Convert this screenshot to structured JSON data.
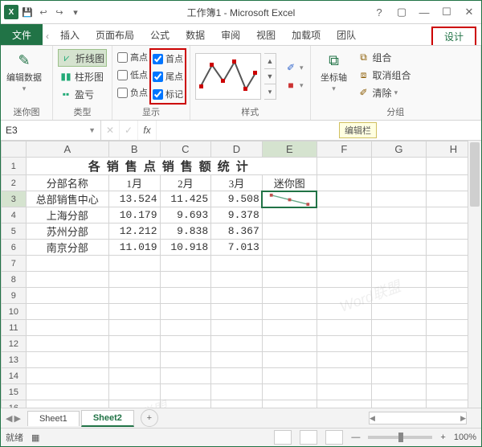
{
  "window": {
    "title": "工作簿1 - Microsoft Excel"
  },
  "qat": {
    "save": "💾",
    "undo": "↩",
    "redo": "↪",
    "dd": "▾"
  },
  "tabs": {
    "file": "文件",
    "items": [
      "插入",
      "页面布局",
      "公式",
      "数据",
      "审阅",
      "视图",
      "加载项",
      "团队"
    ],
    "design": "设计"
  },
  "ribbon": {
    "groups": {
      "mini": "迷你图",
      "type": "类型",
      "show": "显示",
      "style": "样式",
      "group": "分组"
    },
    "edit_data": "编辑数据",
    "types": {
      "line": "折线图",
      "column": "柱形图",
      "winloss": "盈亏"
    },
    "show": {
      "high": "高点",
      "low": "低点",
      "neg": "负点",
      "first": "首点",
      "last": "尾点",
      "markers": "标记"
    },
    "axis": "坐标轴",
    "grp": {
      "combine": "组合",
      "ungroup": "取消组合",
      "clear": "清除"
    }
  },
  "formula_bar": {
    "namebox": "E3",
    "fx": "fx",
    "tip": "编辑栏"
  },
  "sheet": {
    "columns": [
      "A",
      "B",
      "C",
      "D",
      "E",
      "F",
      "G",
      "H"
    ],
    "title": "各销售点销售额统计",
    "headers": {
      "name": "分部名称",
      "m1": "1月",
      "m2": "2月",
      "m3": "3月",
      "spark": "迷你图"
    },
    "rows": [
      {
        "name": "总部销售中心",
        "m1": "13.524",
        "m2": "11.425",
        "m3": "9.508"
      },
      {
        "name": "上海分部",
        "m1": "10.179",
        "m2": "9.693",
        "m3": "9.378"
      },
      {
        "name": "苏州分部",
        "m1": "12.212",
        "m2": "9.838",
        "m3": "8.367"
      },
      {
        "name": "南京分部",
        "m1": "11.019",
        "m2": "10.918",
        "m3": "7.013"
      }
    ],
    "row_count": 16
  },
  "sheet_tabs": {
    "tabs": [
      "Sheet1",
      "Sheet2"
    ],
    "active": 1
  },
  "status": {
    "ready": "就绪",
    "zoom": "100%"
  },
  "chart_data": {
    "type": "line",
    "note": "迷你图 sparkline in E3 plus ribbon style preview",
    "categories": [
      "1月",
      "2月",
      "3月"
    ],
    "series": [
      {
        "name": "总部销售中心",
        "values": [
          13.524,
          11.425,
          9.508
        ]
      }
    ]
  },
  "watermark": "Word联盟"
}
